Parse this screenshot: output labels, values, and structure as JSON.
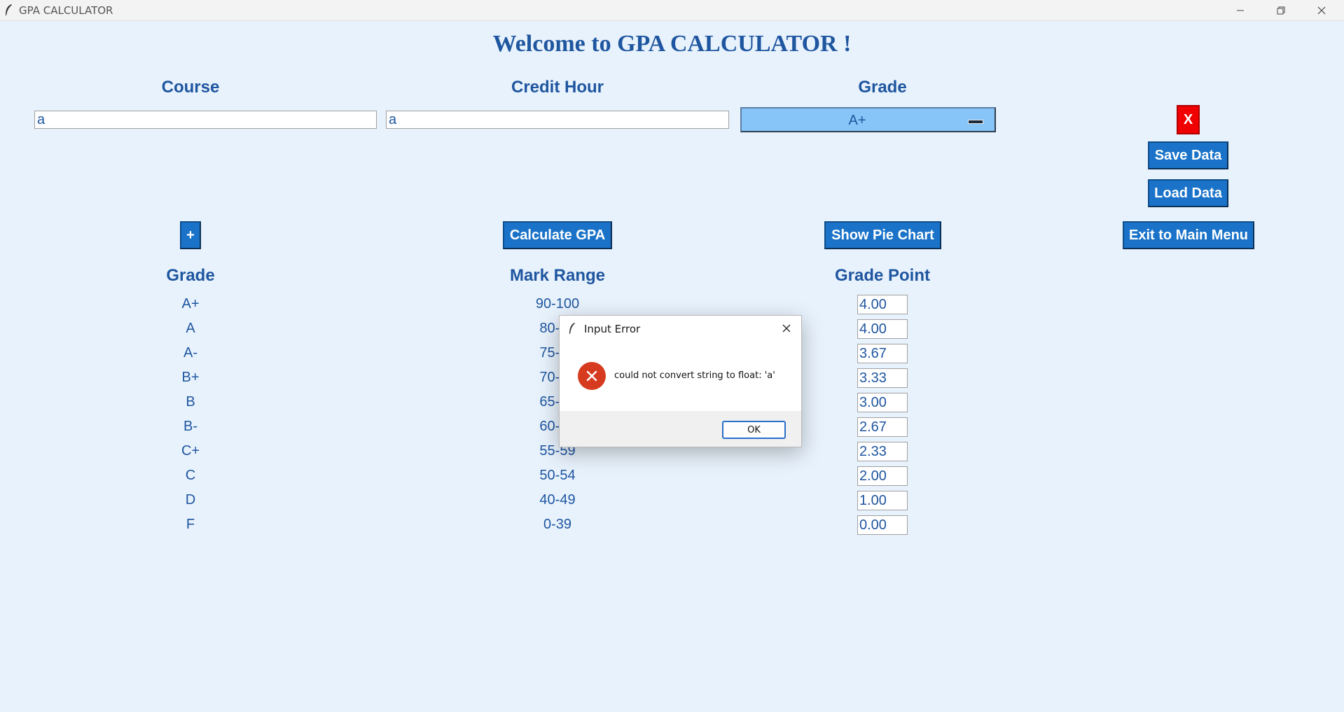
{
  "window": {
    "title": "GPA CALCULATOR"
  },
  "welcome": "Welcome to GPA CALCULATOR !",
  "input_headers": {
    "course": "Course",
    "credit_hour": "Credit Hour",
    "grade": "Grade"
  },
  "inputs": {
    "course_value": "a",
    "credit_hour_value": "a",
    "grade_selected": "A+"
  },
  "buttons": {
    "remove": "X",
    "save": "Save Data",
    "load": "Load Data",
    "add": "+",
    "calculate": "Calculate GPA",
    "pie": "Show Pie Chart",
    "exit": "Exit to Main Menu"
  },
  "table": {
    "headers": {
      "grade": "Grade",
      "mark_range": "Mark Range",
      "grade_point": "Grade Point"
    },
    "rows": [
      {
        "grade": "A+",
        "range": "90-100",
        "point": "4.00"
      },
      {
        "grade": "A",
        "range": "80-89",
        "point": "4.00"
      },
      {
        "grade": "A-",
        "range": "75-79",
        "point": "3.67"
      },
      {
        "grade": "B+",
        "range": "70-74",
        "point": "3.33"
      },
      {
        "grade": "B",
        "range": "65-69",
        "point": "3.00"
      },
      {
        "grade": "B-",
        "range": "60-64",
        "point": "2.67"
      },
      {
        "grade": "C+",
        "range": "55-59",
        "point": "2.33"
      },
      {
        "grade": "C",
        "range": "50-54",
        "point": "2.00"
      },
      {
        "grade": "D",
        "range": "40-49",
        "point": "1.00"
      },
      {
        "grade": "F",
        "range": "0-39",
        "point": "0.00"
      }
    ]
  },
  "dialog": {
    "title": "Input Error",
    "message": "could not convert string to float: 'a'",
    "ok": "OK"
  },
  "colors": {
    "accent": "#1a73c9",
    "text": "#1f56a0",
    "background": "#e8f2fc",
    "danger": "#f00000"
  }
}
